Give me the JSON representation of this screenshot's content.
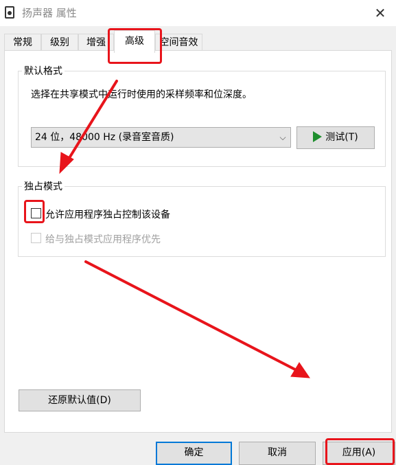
{
  "window": {
    "title": "扬声器 属性",
    "close_glyph": "✕"
  },
  "tabs": [
    {
      "label": "常规"
    },
    {
      "label": "级别"
    },
    {
      "label": "增强"
    },
    {
      "label": "高级"
    },
    {
      "label": "空间音效"
    }
  ],
  "active_tab": "高级",
  "default_format": {
    "group_label": "默认格式",
    "description": "选择在共享模式中运行时使用的采样频率和位深度。",
    "selected_format": "24 位，48000 Hz (录音室音质)",
    "test_button": "测试(T)"
  },
  "exclusive_mode": {
    "group_label": "独占模式",
    "allow_exclusive_label": "允许应用程序独占控制该设备",
    "allow_exclusive_checked": false,
    "priority_label": "给与独占模式应用程序优先",
    "priority_checked": false,
    "priority_enabled": false
  },
  "restore_button": "还原默认值(D)",
  "footer": {
    "ok": "确定",
    "cancel": "取消",
    "apply": "应用(A)"
  },
  "annotation_color": "#e8141b",
  "icons": {
    "app": "speaker-icon",
    "test": "play-icon",
    "dropdown": "chevron-down-icon"
  }
}
